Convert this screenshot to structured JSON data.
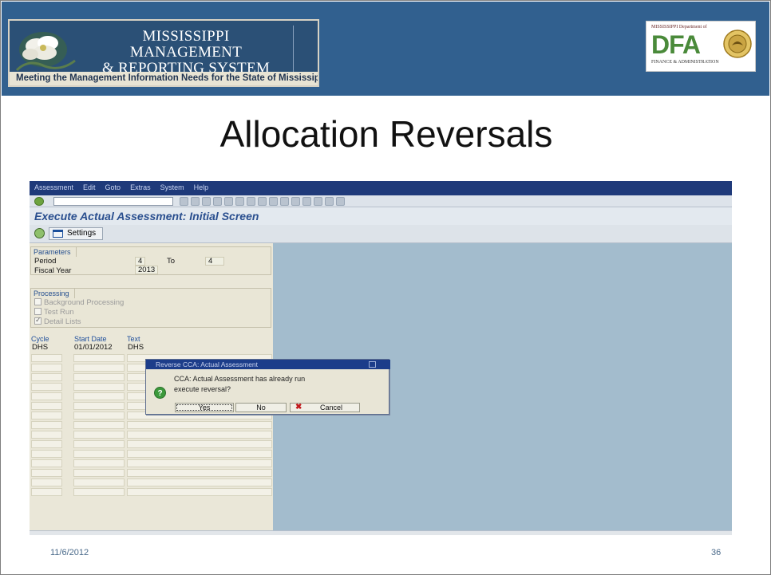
{
  "header": {
    "logo_title": "MISSISSIPPI MANAGEMENT\n& REPORTING SYSTEM",
    "logo_title_line1": "MISSISSIPPI MANAGEMENT",
    "logo_title_line2": "& REPORTING SYSTEM",
    "tagline": "Meeting the Management Information Needs for the State of Mississippi",
    "dfa_top": "MISSISSIPPI Department of",
    "dfa_letters": "DFA",
    "dfa_bottom": "FINANCE & ADMINISTRATION"
  },
  "slide": {
    "title": "Allocation Reversals",
    "date": "11/6/2012",
    "page_number": "36"
  },
  "sap": {
    "menu": [
      "Assessment",
      "Edit",
      "Goto",
      "Extras",
      "System",
      "Help"
    ],
    "screen_title": "Execute Actual Assessment: Initial Screen",
    "settings_label": "Settings",
    "parameters": {
      "group_label": "Parameters",
      "period_label": "Period",
      "period_from": "4",
      "to_label": "To",
      "period_to": "4",
      "fiscal_year_label": "Fiscal Year",
      "fiscal_year": "2013"
    },
    "processing": {
      "group_label": "Processing",
      "background_label": "Background Processing",
      "test_run_label": "Test Run",
      "detail_lists_label": "Detail Lists"
    },
    "table": {
      "headers": [
        "Cycle",
        "Start Date",
        "Text"
      ],
      "rows": [
        {
          "cycle": "DHS",
          "start_date": "01/01/2012",
          "text": "DHS"
        }
      ]
    },
    "dialog": {
      "title": "Reverse CCA: Actual Assessment",
      "message_line1": "CCA: Actual Assessment has already run",
      "message_line2": "execute reversal?",
      "yes_label": "Yes",
      "no_label": "No",
      "cancel_label": "Cancel"
    }
  }
}
